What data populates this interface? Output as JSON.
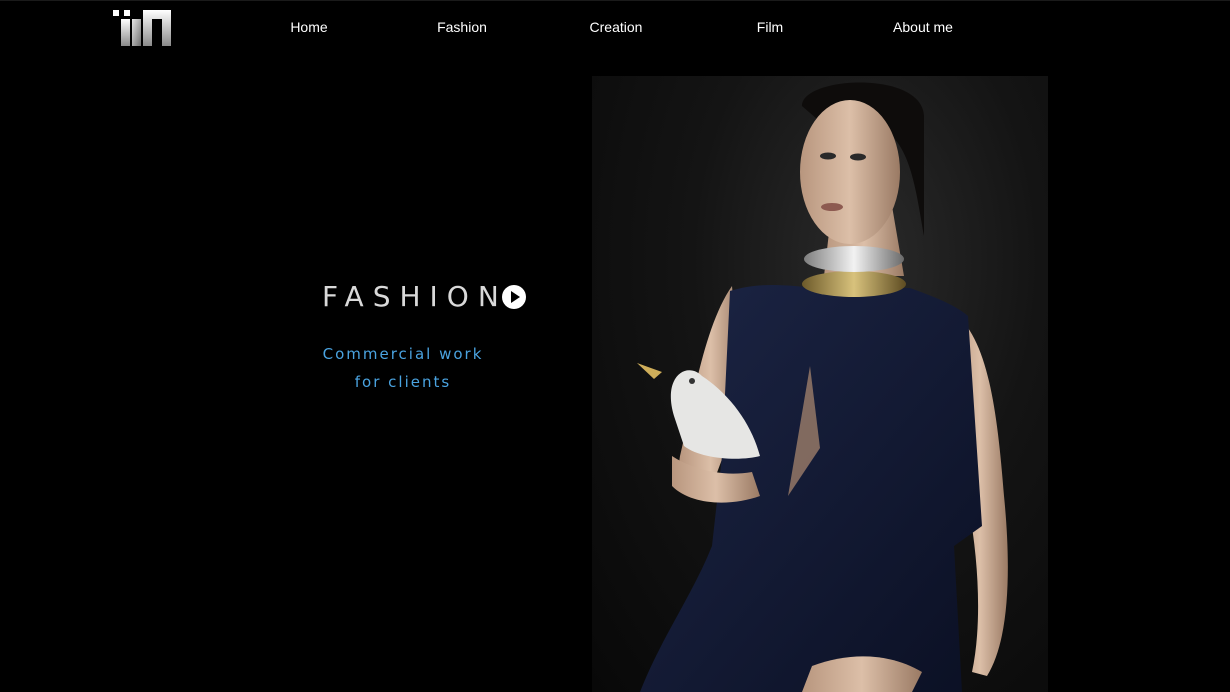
{
  "logo": {
    "alt_icon": "iiin-logo-icon"
  },
  "nav": {
    "items": [
      {
        "label": "Home"
      },
      {
        "label": "Fashion"
      },
      {
        "label": "Creation"
      },
      {
        "label": "Film"
      },
      {
        "label": "About me"
      }
    ]
  },
  "hero": {
    "title": "FASHION",
    "play_icon": "play-circle-icon",
    "subtitle_line1": "Commercial work",
    "subtitle_line2": "for clients"
  },
  "photo": {
    "subject": "fashion-portrait-image"
  },
  "colors": {
    "background": "#000000",
    "nav_text": "#ffffff",
    "title_text": "#d9d9d9",
    "accent_blue": "#4aa3e0",
    "dress_navy": "#141b33"
  }
}
